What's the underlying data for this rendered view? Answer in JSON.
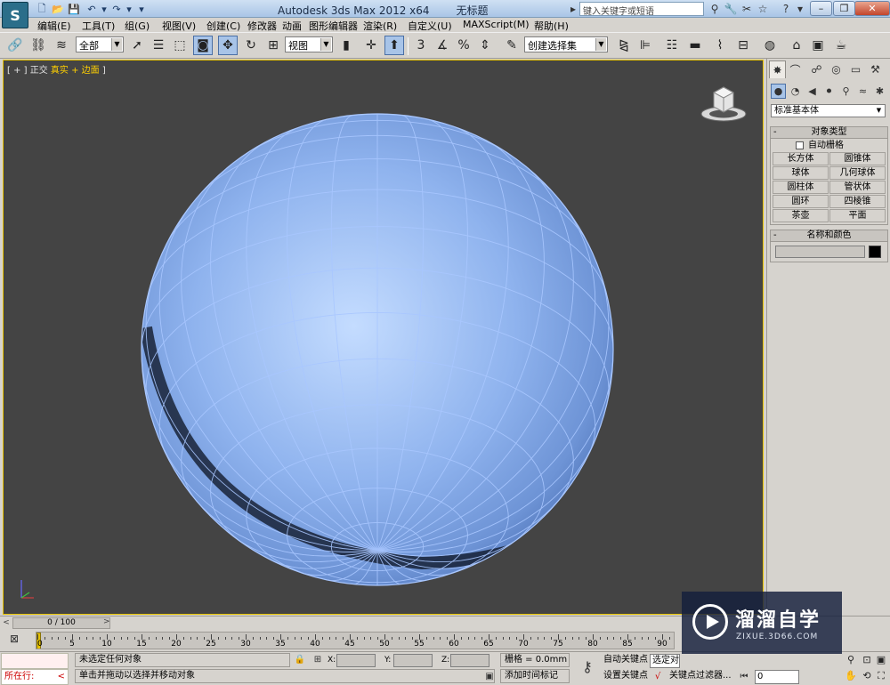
{
  "titlebar": {
    "app_name": "Autodesk 3ds Max  2012 x64",
    "doc_name": "无标题",
    "search_placeholder": "键入关键字或短语",
    "logo_letter": "S"
  },
  "menu": [
    "编辑(E)",
    "工具(T)",
    "组(G)",
    "视图(V)",
    "创建(C)",
    "修改器",
    "动画",
    "图形编辑器",
    "渲染(R)",
    "自定义(U)",
    "MAXScript(M)",
    "帮助(H)"
  ],
  "toolbar": {
    "selection_filter": "全部",
    "ref_coord": "视图",
    "named_selection": "创建选择集"
  },
  "viewport": {
    "label_prefix": "[ + ] ",
    "label_view": "正交",
    "label_shading": "真实 + 边面",
    "label_suffix": " ]"
  },
  "command_panel": {
    "category": "标准基本体",
    "object_type_title": "对象类型",
    "autogrid": "自动栅格",
    "objects": [
      "长方体",
      "圆锥体",
      "球体",
      "几何球体",
      "圆柱体",
      "管状体",
      "圆环",
      "四棱锥",
      "茶壶",
      "平面"
    ],
    "name_color_title": "名称和颜色",
    "object_color": "#000000"
  },
  "timeslider": {
    "frame_label": "0 / 100"
  },
  "trackbar": {
    "ticks": [
      0,
      5,
      10,
      15,
      20,
      25,
      30,
      35,
      40,
      45,
      50,
      55,
      60,
      65,
      70,
      75,
      80,
      85,
      90
    ]
  },
  "status": {
    "listener_text": "所在行:",
    "selection_status": "未选定任何对象",
    "prompt": "单击并拖动以选择并移动对象",
    "x_label": "X:",
    "y_label": "Y:",
    "z_label": "Z:",
    "grid": "栅格 = 0.0mm",
    "add_time_tag": "添加时间标记",
    "auto_key": "自动关键点",
    "set_key": "设置关键点",
    "selected_object": "选定对象",
    "key_filters": "关键点过滤器...",
    "current_frame": "0"
  },
  "watermark": {
    "title": "溜溜自学",
    "url": "ZIXUE.3D66.COM"
  },
  "colors": {
    "viewport_bg": "#444444",
    "sphere": "#8aaee8",
    "wireframe": "#a9c7ff",
    "active_border": "#e6c200"
  }
}
